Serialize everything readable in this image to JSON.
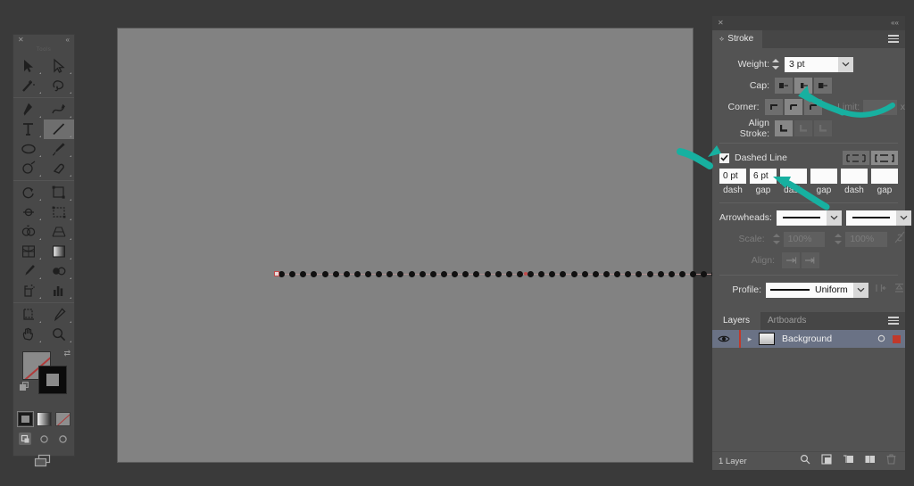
{
  "app": "Adobe Illustrator",
  "colors": {
    "accent_teal": "#17b0a0",
    "panel_bg": "#535353",
    "app_bg": "#3a3a3a",
    "canvas_bg": "#828282",
    "selection_blue": "#6a7285",
    "anchor_red": "#c14b4b"
  },
  "toolbar": {
    "close_glyph": "✕",
    "collapse_glyph": "«",
    "title": "Tools",
    "tools": [
      {
        "name": "selection-tool",
        "label": "Selection"
      },
      {
        "name": "direct-selection-tool",
        "label": "Direct Selection"
      },
      {
        "name": "magic-wand-tool",
        "label": "Magic Wand"
      },
      {
        "name": "lasso-tool",
        "label": "Lasso"
      },
      {
        "name": "pen-tool",
        "label": "Pen"
      },
      {
        "name": "curvature-tool",
        "label": "Curvature"
      },
      {
        "name": "type-tool",
        "label": "Type"
      },
      {
        "name": "line-segment-tool",
        "label": "Line Segment",
        "selected": true
      },
      {
        "name": "ellipse-tool",
        "label": "Ellipse"
      },
      {
        "name": "paintbrush-tool",
        "label": "Paintbrush"
      },
      {
        "name": "shaper-tool",
        "label": "Shaper"
      },
      {
        "name": "eraser-tool",
        "label": "Eraser"
      },
      {
        "name": "rotate-tool",
        "label": "Rotate"
      },
      {
        "name": "scale-tool",
        "label": "Scale"
      },
      {
        "name": "width-tool",
        "label": "Width"
      },
      {
        "name": "free-transform-tool",
        "label": "Free Transform"
      },
      {
        "name": "shape-builder-tool",
        "label": "Shape Builder"
      },
      {
        "name": "perspective-grid-tool",
        "label": "Perspective Grid"
      },
      {
        "name": "mesh-tool",
        "label": "Mesh"
      },
      {
        "name": "gradient-tool",
        "label": "Gradient"
      },
      {
        "name": "eyedropper-tool",
        "label": "Eyedropper"
      },
      {
        "name": "blend-tool",
        "label": "Blend"
      },
      {
        "name": "symbol-sprayer-tool",
        "label": "Symbol Sprayer"
      },
      {
        "name": "column-graph-tool",
        "label": "Column Graph"
      },
      {
        "name": "artboard-tool",
        "label": "Artboard"
      },
      {
        "name": "slice-tool",
        "label": "Slice"
      },
      {
        "name": "hand-tool",
        "label": "Hand"
      },
      {
        "name": "zoom-tool",
        "label": "Zoom"
      }
    ],
    "fill_label": "Fill (None)",
    "stroke_label": "Stroke (Black)",
    "swap_glyph": "⇄",
    "draw_modes": [
      "draw-normal",
      "draw-behind",
      "draw-inside"
    ]
  },
  "stroke_panel": {
    "close_glyph": "✕",
    "collapse_glyph": "««",
    "tab_label": "Stroke",
    "tab_toggle_glyph": "⟡",
    "weight_label": "Weight:",
    "weight_value": "3 pt",
    "cap_label": "Cap:",
    "caps": [
      {
        "name": "butt-cap",
        "selected": false
      },
      {
        "name": "round-cap",
        "selected": true
      },
      {
        "name": "projecting-cap",
        "selected": false
      }
    ],
    "corner_label": "Corner:",
    "corners": [
      {
        "name": "miter-join",
        "selected": false
      },
      {
        "name": "round-join",
        "selected": true
      },
      {
        "name": "bevel-join",
        "selected": false
      }
    ],
    "limit_label": "Limit:",
    "limit_value": "",
    "limit_suffix": "x",
    "align_label": "Align Stroke:",
    "aligns": [
      {
        "name": "align-center",
        "selected": true
      },
      {
        "name": "align-inside",
        "selected": false
      },
      {
        "name": "align-outside",
        "selected": false
      }
    ],
    "dashed_line_label": "Dashed Line",
    "dashed_checked": true,
    "dash_mode_buttons": [
      {
        "name": "dashes-preserve-exact-lengths",
        "selected": false
      },
      {
        "name": "dashes-adjust-to-corners",
        "selected": true
      }
    ],
    "dash_fields": [
      {
        "value": "0 pt",
        "caption": "dash"
      },
      {
        "value": "6 pt",
        "caption": "gap"
      },
      {
        "value": "",
        "caption": "dash"
      },
      {
        "value": "",
        "caption": "gap"
      },
      {
        "value": "",
        "caption": "dash"
      },
      {
        "value": "",
        "caption": "gap"
      }
    ],
    "arrowheads_label": "Arrowheads:",
    "arrowhead_start": "None",
    "arrowhead_end": "None",
    "swap_arrowheads_glyph": "⇄",
    "scale_label": "Scale:",
    "scale_start": "100%",
    "scale_end": "100%",
    "link_scales_glyph": "link",
    "align_arrow_label": "Align:",
    "align_arrow_buttons": [
      "extend-arrow-tip-beyond-end",
      "place-arrow-tip-at-end"
    ],
    "profile_label": "Profile:",
    "profile_value": "Uniform",
    "flip_along_glyph": "⊣⊢",
    "flip_across_glyph": "⊼"
  },
  "layers_panel": {
    "tabs": [
      {
        "name": "tab-layers",
        "label": "Layers",
        "active": true
      },
      {
        "name": "tab-artboards",
        "label": "Artboards",
        "active": false
      }
    ],
    "menu_glyph": "≡",
    "rows": [
      {
        "name": "Background",
        "visible": true,
        "locked": false,
        "expanded": false,
        "selected": true,
        "selection_color": "#c0392b"
      }
    ],
    "footer_count": "1 Layer",
    "footer_icons": [
      "locate-object-icon",
      "make-clipping-mask-icon",
      "create-new-sublayer-icon",
      "create-new-layer-icon",
      "delete-selection-icon"
    ]
  },
  "canvas": {
    "artwork_name": "dotted-line-path",
    "dot_count": 46,
    "stroke_weight_pt": 3,
    "dash_pattern": "0 pt dash / 6 pt gap",
    "cap": "round",
    "anchor_points": [
      "start",
      "middle",
      "end"
    ]
  },
  "annotations": [
    {
      "name": "arrow-to-round-cap",
      "target": "round-cap-button",
      "color": "#17b0a0"
    },
    {
      "name": "arrow-to-dashed-line-checkbox",
      "target": "dashed-line-checkbox",
      "color": "#17b0a0"
    },
    {
      "name": "arrow-to-gap-field",
      "target": "dash-gap-field",
      "color": "#17b0a0"
    }
  ]
}
